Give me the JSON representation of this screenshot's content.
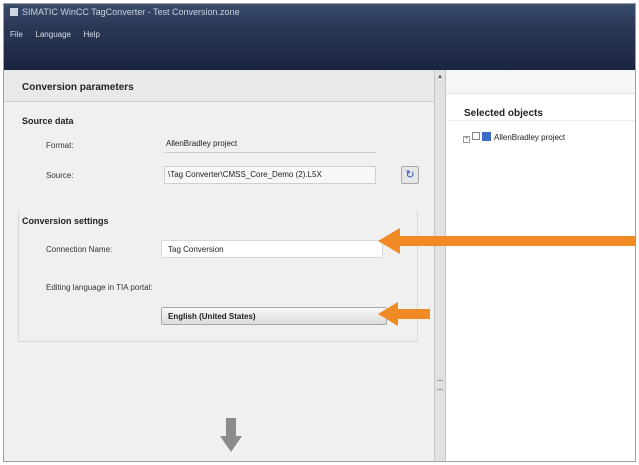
{
  "window": {
    "title": "SIMATIC WinCC TagConverter - Test Conversion.zone"
  },
  "menu": {
    "items": [
      "File",
      "Language",
      "Help"
    ]
  },
  "conversion_parameters": {
    "heading": "Conversion parameters",
    "source_data": {
      "heading": "Source data",
      "format_label": "Format:",
      "format_value": "AllenBradley project",
      "source_label": "Source:",
      "source_value": "\\Tag Converter\\CMSS_Core_Demo (2).L5X"
    },
    "conversion_settings": {
      "heading": "Conversion settings",
      "connection_name_label": "Connection Name:",
      "connection_name_value": "Tag Conversion",
      "editing_language_label": "Editing language in TIA portal:",
      "editing_language_value": "English (United States)"
    }
  },
  "selected_objects": {
    "heading": "Selected objects",
    "tree": [
      {
        "expander": "+",
        "label": "AllenBradley project"
      }
    ]
  },
  "icons": {
    "refresh": "refresh-icon",
    "down_arrow": "down-arrow-icon",
    "callouts": "orange-arrow-icon"
  },
  "colors": {
    "callout_orange": "#f08a24",
    "title_bar": "#2c3a57"
  }
}
